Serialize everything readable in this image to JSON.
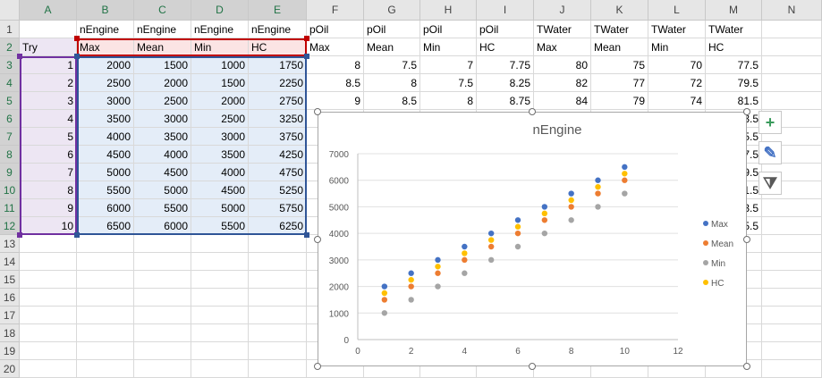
{
  "columns": [
    "A",
    "B",
    "C",
    "D",
    "E",
    "F",
    "G",
    "H",
    "I",
    "J",
    "K",
    "L",
    "M",
    "N"
  ],
  "rows": [
    "1",
    "2",
    "3",
    "4",
    "5",
    "6",
    "7",
    "8",
    "9",
    "10",
    "11",
    "12",
    "13",
    "14",
    "15",
    "16",
    "17",
    "18",
    "19",
    "20"
  ],
  "row1": [
    "",
    "nEngine",
    "nEngine",
    "nEngine",
    "nEngine",
    "pOil",
    "pOil",
    "pOil",
    "pOil",
    "TWater",
    "TWater",
    "TWater",
    "TWater",
    ""
  ],
  "row2": [
    "Try",
    "Max",
    "Mean",
    "Min",
    "HC",
    "Max",
    "Mean",
    "Min",
    "HC",
    "Max",
    "Mean",
    "Min",
    "HC",
    ""
  ],
  "data": [
    [
      "1",
      "2000",
      "1500",
      "1000",
      "1750",
      "8",
      "7.5",
      "7",
      "7.75",
      "80",
      "75",
      "70",
      "77.5"
    ],
    [
      "2",
      "2500",
      "2000",
      "1500",
      "2250",
      "8.5",
      "8",
      "7.5",
      "8.25",
      "82",
      "77",
      "72",
      "79.5"
    ],
    [
      "3",
      "3000",
      "2500",
      "2000",
      "2750",
      "9",
      "8.5",
      "8",
      "8.75",
      "84",
      "79",
      "74",
      "81.5"
    ],
    [
      "4",
      "3500",
      "3000",
      "2500",
      "3250",
      "",
      "",
      "",
      "",
      "",
      "",
      "",
      "3.5"
    ],
    [
      "5",
      "4000",
      "3500",
      "3000",
      "3750",
      "",
      "",
      "",
      "",
      "",
      "",
      "",
      "5.5"
    ],
    [
      "6",
      "4500",
      "4000",
      "3500",
      "4250",
      "",
      "",
      "",
      "",
      "",
      "",
      "",
      "7.5"
    ],
    [
      "7",
      "5000",
      "4500",
      "4000",
      "4750",
      "",
      "",
      "",
      "",
      "",
      "",
      "",
      "9.5"
    ],
    [
      "8",
      "5500",
      "5000",
      "4500",
      "5250",
      "",
      "",
      "",
      "",
      "",
      "",
      "",
      "1.5"
    ],
    [
      "9",
      "6000",
      "5500",
      "5000",
      "5750",
      "",
      "",
      "",
      "",
      "",
      "",
      "",
      "3.5"
    ],
    [
      "10",
      "6500",
      "6000",
      "5500",
      "6250",
      "",
      "",
      "",
      "",
      "",
      "",
      "",
      "5.5"
    ]
  ],
  "chart_data": {
    "type": "scatter",
    "title": "nEngine",
    "x": [
      1,
      2,
      3,
      4,
      5,
      6,
      7,
      8,
      9,
      10
    ],
    "series": [
      {
        "name": "Max",
        "color": "#4472c4",
        "values": [
          2000,
          2500,
          3000,
          3500,
          4000,
          4500,
          5000,
          5500,
          6000,
          6500
        ]
      },
      {
        "name": "Mean",
        "color": "#ed7d31",
        "values": [
          1500,
          2000,
          2500,
          3000,
          3500,
          4000,
          4500,
          5000,
          5500,
          6000
        ]
      },
      {
        "name": "Min",
        "color": "#a5a5a5",
        "values": [
          1000,
          1500,
          2000,
          2500,
          3000,
          3500,
          4000,
          4500,
          5000,
          5500
        ]
      },
      {
        "name": "HC",
        "color": "#ffc000",
        "values": [
          1750,
          2250,
          2750,
          3250,
          3750,
          4250,
          4750,
          5250,
          5750,
          6250
        ]
      }
    ],
    "xlim": [
      0,
      12
    ],
    "ylim": [
      0,
      7000
    ],
    "xticks": [
      "0",
      "2",
      "4",
      "6",
      "8",
      "10",
      "12"
    ],
    "yticks": [
      "0",
      "1000",
      "2000",
      "3000",
      "4000",
      "5000",
      "6000",
      "7000"
    ],
    "grid": "horizontal",
    "legend": "right"
  },
  "side_buttons": [
    {
      "icon": "plus-icon",
      "glyph": "+"
    },
    {
      "icon": "brush-icon",
      "glyph": "✎"
    },
    {
      "icon": "filter-icon",
      "glyph": "⧩"
    }
  ],
  "colors": {
    "selection_red": "#c00000",
    "selection_purple": "#7030a0",
    "selection_blue": "#2f5597",
    "fill_red": "#fbe4e4",
    "fill_purple": "#ede6f3",
    "fill_blue": "#e4edf8"
  }
}
